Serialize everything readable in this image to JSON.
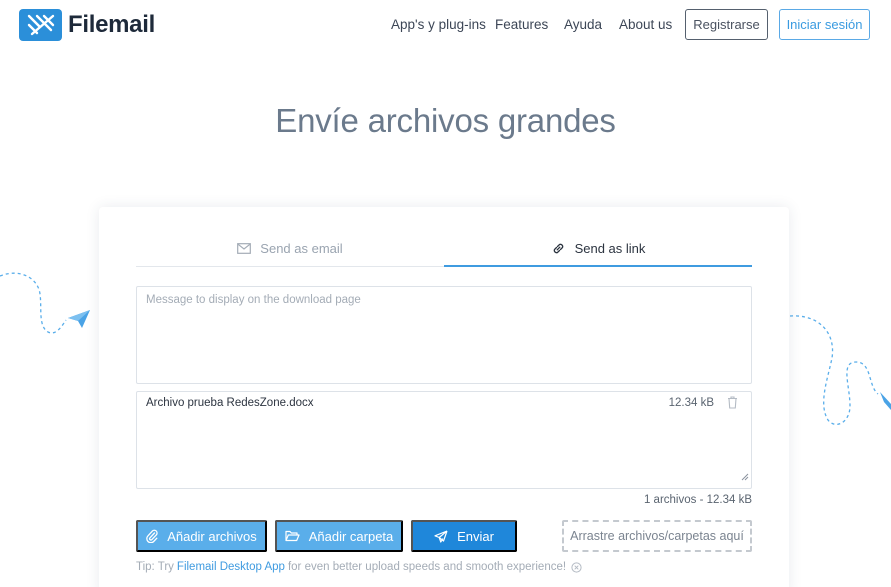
{
  "header": {
    "logo_text": "Filemail",
    "nav": [
      {
        "label": "App's y plug-ins"
      },
      {
        "label": "Features"
      },
      {
        "label": "Ayuda"
      },
      {
        "label": "About us"
      }
    ],
    "register_label": "Registrarse",
    "login_label": "Iniciar sesión"
  },
  "hero": {
    "title": "Envíe archivos grandes"
  },
  "tabs": {
    "email": {
      "label": "Send as email",
      "icon": "envelope-icon"
    },
    "link": {
      "label": "Send as link",
      "icon": "link-icon",
      "active": true
    }
  },
  "message": {
    "placeholder": "Message to display on the download page",
    "value": ""
  },
  "files": [
    {
      "name": "Archivo prueba RedesZone.docx",
      "size": "12.34 kB"
    }
  ],
  "summary": "1 archivos - 12.34 kB",
  "actions": {
    "add_files_label": "Añadir archivos",
    "add_folder_label": "Añadir carpeta",
    "send_label": "Enviar",
    "dropzone_label": "Arrastre archivos/carpetas aquí"
  },
  "tip": {
    "prefix": "Tip: Try",
    "link": "Filemail Desktop App",
    "suffix": "for even better upload speeds and smooth experience!"
  },
  "colors": {
    "brand": "#2b8fd9",
    "accent": "#3f9be0",
    "button": "#5aaeea",
    "send_button": "#1f87da"
  }
}
